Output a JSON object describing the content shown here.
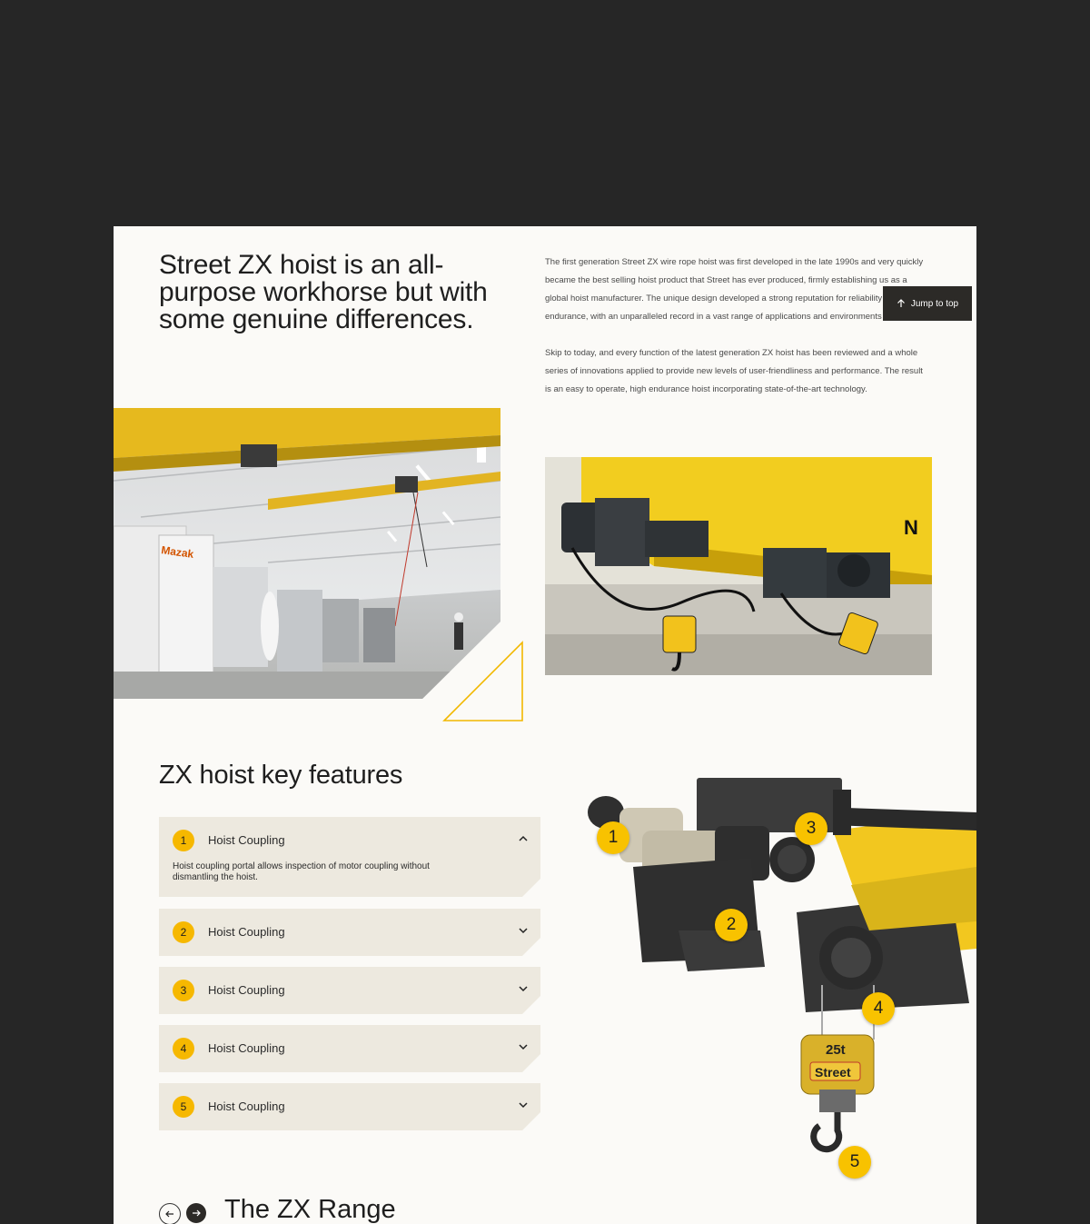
{
  "hero": {
    "title": "Street ZX hoist is an all-purpose workhorse but with some genuine differences.",
    "paragraphs": [
      "The first generation Street ZX wire rope hoist was first developed in the late 1990s and very quickly became the best selling hoist product that Street has ever produced, firmly establishing us as a global hoist manufacturer. The unique design developed a strong reputation for reliability and endurance, with an unparalleled record in a vast range of applications and environments worldwide.",
      "Skip to today, and every function of the latest generation ZX hoist has been reviewed and a whole series of innovations applied to provide new levels of user-friendliness and performance. The result is an easy to operate, high endurance hoist incorporating state-of-the-art technology."
    ]
  },
  "jump_to_top": {
    "label": "Jump to top",
    "icon": "arrow-up-icon"
  },
  "photos": {
    "factory_sign": "Mazak",
    "hoist_sign": "N"
  },
  "features": {
    "title": "ZX hoist key features",
    "items": [
      {
        "number": "1",
        "label": "Hoist Coupling",
        "expanded": true,
        "body": "Hoist coupling portal allows inspection of motor coupling without dismantling the hoist."
      },
      {
        "number": "2",
        "label": "Hoist Coupling",
        "expanded": false
      },
      {
        "number": "3",
        "label": "Hoist Coupling",
        "expanded": false
      },
      {
        "number": "4",
        "label": "Hoist Coupling",
        "expanded": false
      },
      {
        "number": "5",
        "label": "Hoist Coupling",
        "expanded": false
      }
    ],
    "markers": [
      "1",
      "2",
      "3",
      "4",
      "5"
    ],
    "block_label": "25t",
    "brand": "Street"
  },
  "range": {
    "title": "The ZX Range",
    "prev_icon": "arrow-left-icon",
    "next_icon": "arrow-right-icon"
  },
  "colors": {
    "background": "#262626",
    "page": "#fbfaf7",
    "accent_yellow": "#f6b800",
    "accordion": "#ede9df",
    "dark": "#2c2a27"
  }
}
